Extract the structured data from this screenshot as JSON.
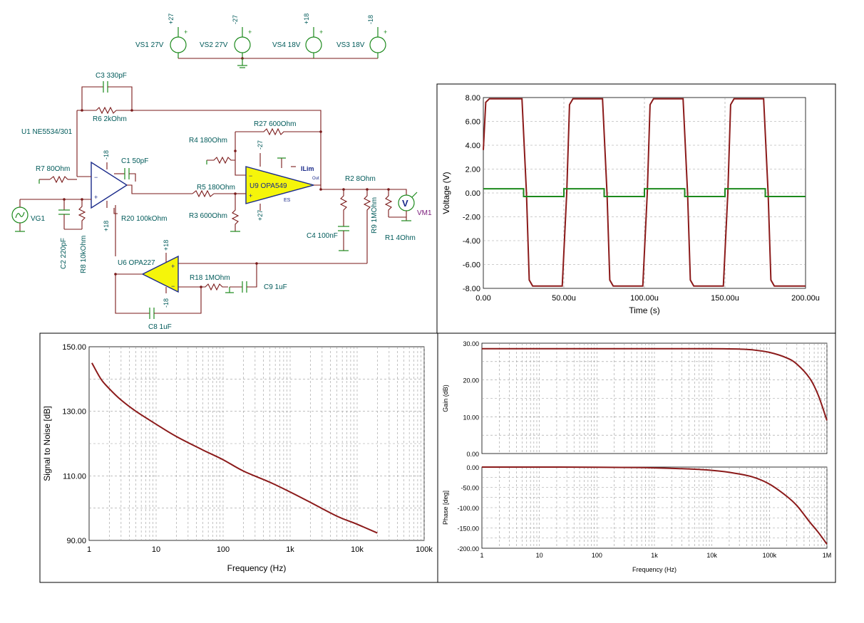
{
  "schematic": {
    "sources": [
      {
        "name": "VS1 27V",
        "rail": "+27"
      },
      {
        "name": "VS2 27V",
        "rail": "-27"
      },
      {
        "name": "VS4 18V",
        "rail": "+18"
      },
      {
        "name": "VS3 18V",
        "rail": "-18"
      }
    ],
    "components": {
      "c3": "C3 330pF",
      "r6": "R6 2kOhm",
      "u1": "U1 NE5534/301",
      "r7": "R7 80Ohm",
      "c1": "C1 50pF",
      "vg1": "VG1",
      "c2": "C2 220pF",
      "r8": "R8 10kOhm",
      "r20": "R20 100kOhm",
      "r5": "R5 180Ohm",
      "r3": "R3 600Ohm",
      "r4": "R4 180Ohm",
      "r27": "R27 600Ohm",
      "u9": "U9 OPA549",
      "r2": "R2 8Ohm",
      "vm1": "VM1",
      "c4": "C4 100nF",
      "r9": "R9 1MOhm",
      "r1": "R1 4Ohm",
      "u6": "U6 OPA227",
      "r18": "R18 1MOhm",
      "c9": "C9 1uF",
      "c8": "C8 1uF"
    },
    "pin_labels": {
      "u1_neg": "-18",
      "u1_pos": "+18",
      "u9_neg": "-27",
      "u9_pos": "+27",
      "u9_ilim": "ILim",
      "u9_es": "ES",
      "u9_out": "Out",
      "u6_pos": "+18",
      "u6_neg": "-18",
      "vm_symbol": "V"
    }
  },
  "chart_data": [
    {
      "id": "transient",
      "type": "line",
      "xlabel": "Time (s)",
      "ylabel": "Voltage (V)",
      "xlim": [
        0,
        0.0002
      ],
      "ylim": [
        -8,
        8
      ],
      "xticks": [
        "0.00",
        "50.00u",
        "100.00u",
        "150.00u",
        "200.00u"
      ],
      "yticks": [
        "8.00",
        "6.00",
        "4.00",
        "2.00",
        "0.00",
        "-2.00",
        "-4.00",
        "-6.00",
        "-8.00"
      ],
      "grid": true,
      "series": [
        {
          "color": "#8b1a1a",
          "kind": "output-square",
          "high": 7.9,
          "low": -7.8,
          "period": 5e-05,
          "x": [
            0,
            2.5e-05,
            5e-05,
            7.5e-05,
            0.0001,
            0.000125,
            0.00015,
            0.000175,
            0.0002
          ],
          "y": [
            3.6,
            7.9,
            -7.8,
            7.9,
            -7.8,
            7.9,
            -7.8,
            7.9,
            -7.8
          ]
        },
        {
          "color": "#1d8a1d",
          "kind": "input-square",
          "high": 0.35,
          "low": -0.3,
          "period": 5e-05,
          "x": [
            0,
            2.5e-05,
            5e-05,
            7.5e-05,
            0.0001,
            0.000125,
            0.00015,
            0.000175,
            0.0002
          ],
          "y": [
            0.35,
            -0.3,
            0.35,
            -0.3,
            0.35,
            -0.3,
            0.35,
            -0.3,
            -0.3
          ]
        }
      ]
    },
    {
      "id": "snr",
      "type": "line",
      "xlabel": "Frequency (Hz)",
      "ylabel": "Signal to Noise [dB]",
      "xscale": "log",
      "xlim": [
        1,
        100000
      ],
      "ylim": [
        90,
        150
      ],
      "xticks": [
        "1",
        "10",
        "100",
        "1k",
        "10k",
        "100k"
      ],
      "yticks": [
        "150.00",
        "130.00",
        "110.00",
        "90.00"
      ],
      "grid": true,
      "series": [
        {
          "color": "#8b1a1a",
          "x": [
            1.1,
            1.5,
            2,
            3,
            5,
            10,
            20,
            50,
            100,
            200,
            500,
            1000,
            2000,
            5000,
            10000,
            20000
          ],
          "y": [
            145,
            140,
            137,
            133.5,
            130,
            126,
            122.2,
            118,
            115,
            111.5,
            108,
            105,
            101.8,
            97.5,
            95,
            92.3
          ]
        }
      ]
    },
    {
      "id": "gain",
      "type": "line",
      "xlabel": "",
      "ylabel": "Gain (dB)",
      "xscale": "log",
      "xlim": [
        1,
        1000000
      ],
      "ylim": [
        0,
        30
      ],
      "yticks": [
        "30.00",
        "20.00",
        "10.00",
        "0.00"
      ],
      "grid": true,
      "series": [
        {
          "color": "#8b1a1a",
          "x": [
            1,
            10,
            100,
            1000,
            10000,
            30000,
            50000,
            100000,
            200000,
            300000,
            500000,
            700000,
            1000000
          ],
          "y": [
            28.5,
            28.5,
            28.5,
            28.5,
            28.5,
            28.4,
            28.2,
            27.5,
            26,
            24.3,
            20.5,
            16,
            9
          ]
        }
      ]
    },
    {
      "id": "phase",
      "type": "line",
      "xlabel": "Frequency (Hz)",
      "ylabel": "Phase [deg]",
      "xscale": "log",
      "xlim": [
        1,
        1000000
      ],
      "ylim": [
        -200,
        0
      ],
      "xticks": [
        "1",
        "10",
        "100",
        "1k",
        "10k",
        "100k",
        "1M"
      ],
      "yticks": [
        "0.00",
        "-50.00",
        "-100.00",
        "-150.00",
        "-200.00"
      ],
      "grid": true,
      "series": [
        {
          "color": "#8b1a1a",
          "x": [
            1,
            10,
            100,
            500,
            1000,
            3000,
            10000,
            20000,
            50000,
            100000,
            200000,
            300000,
            500000,
            700000,
            1000000
          ],
          "y": [
            0,
            0,
            -0.5,
            -1,
            -2,
            -4,
            -8,
            -13,
            -24,
            -42,
            -72,
            -95,
            -135,
            -160,
            -190
          ]
        }
      ]
    }
  ]
}
